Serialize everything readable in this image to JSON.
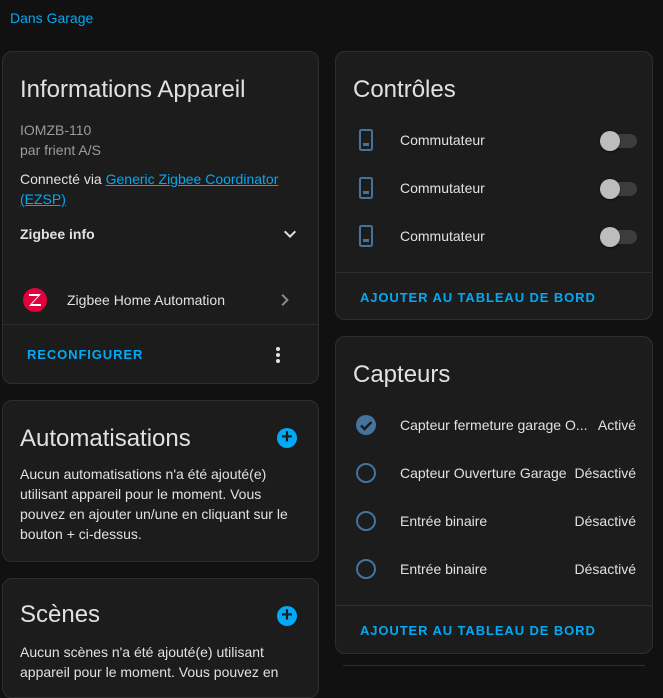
{
  "breadcrumb": {
    "area": "Dans Garage"
  },
  "device_info": {
    "title": "Informations Appareil",
    "model": "IOMZB-110",
    "manufacturer": "par frient A/S",
    "connected_prefix": "Connecté via ",
    "connected_link": "Generic Zigbee Coordinator (EZSP)",
    "zigbee_info_label": "Zigbee info",
    "integration_label": "Zigbee Home Automation",
    "reconfigure_label": "RECONFIGURER"
  },
  "automations": {
    "title": "Automatisations",
    "description": "Aucun automatisations n'a été ajouté(e) utilisant appareil pour le moment. Vous pouvez en ajouter un/une en cliquant sur le bouton + ci-dessus."
  },
  "scenes": {
    "title": "Scènes",
    "description": "Aucun scènes n'a été ajouté(e) utilisant appareil pour le moment. Vous pouvez en"
  },
  "controls": {
    "title": "Contrôles",
    "items": [
      {
        "label": "Commutateur",
        "on": false
      },
      {
        "label": "Commutateur",
        "on": false
      },
      {
        "label": "Commutateur",
        "on": false
      }
    ],
    "add_label": "AJOUTER AU TABLEAU DE BORD"
  },
  "sensors": {
    "title": "Capteurs",
    "items": [
      {
        "label": "Capteur fermeture garage O...",
        "state": "Activé",
        "icon": "check-circle-icon"
      },
      {
        "label": "Capteur Ouverture Garage",
        "state": "Désactivé",
        "icon": "circle-outline-icon"
      },
      {
        "label": "Entrée binaire",
        "state": "Désactivé",
        "icon": "circle-outline-icon"
      },
      {
        "label": "Entrée binaire",
        "state": "Désactivé",
        "icon": "circle-outline-icon"
      }
    ],
    "add_label": "AJOUTER AU TABLEAU DE BORD"
  },
  "colors": {
    "accent": "#03a9f4",
    "zha_brand": "#e2003d",
    "icon_blue": "#44739e"
  }
}
